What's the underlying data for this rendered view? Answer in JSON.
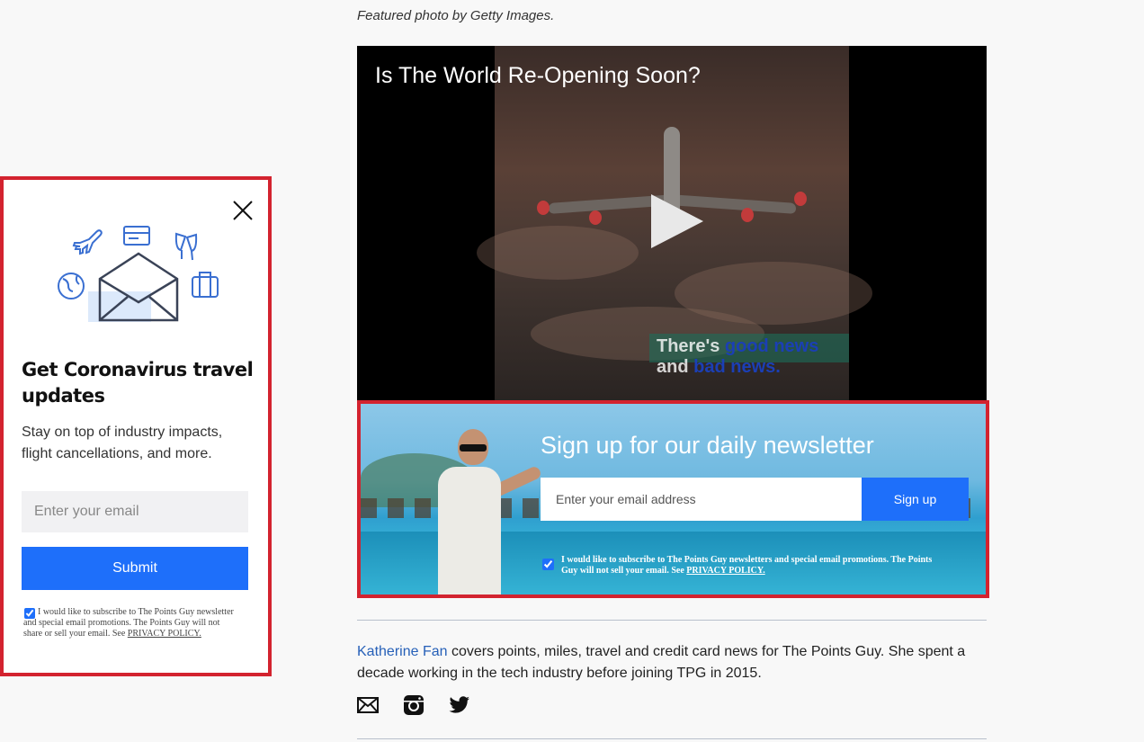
{
  "caption": "Featured photo by Getty Images.",
  "video": {
    "title": "Is The World Re-Opening Soon?",
    "subtitle_1": "There's ",
    "subtitle_2": "good news",
    "subtitle_3": " and ",
    "subtitle_4": "bad news."
  },
  "newsletter": {
    "title": "Sign up for our daily newsletter",
    "email_placeholder": "Enter your email address",
    "button_label": "Sign up",
    "consent_text": "I would like to subscribe to The Points Guy newsletters and special email promotions. The Points Guy will not sell your email. See ",
    "privacy_label": "PRIVACY POLICY."
  },
  "bio": {
    "author": "Katherine Fan",
    "text": " covers points, miles, travel and credit card news for The Points Guy. She spent a decade working in the tech industry before joining TPG in 2015."
  },
  "social": {
    "icons": [
      "mail-icon",
      "instagram-icon",
      "twitter-icon"
    ]
  },
  "popup": {
    "title": "Get Coronavirus travel updates",
    "subtitle": "Stay on top of industry impacts, flight cancellations, and more.",
    "email_placeholder": "Enter your email",
    "button_label": "Submit",
    "consent_text": "I would like to subscribe to The Points Guy newsletter and special email promotions. The Points Guy will not share or sell your email. See ",
    "privacy_label": "PRIVACY POLICY."
  },
  "colors": {
    "accent_blue": "#1e6ffa",
    "highlight_red": "#d3232f",
    "link_blue": "#2660b8"
  }
}
